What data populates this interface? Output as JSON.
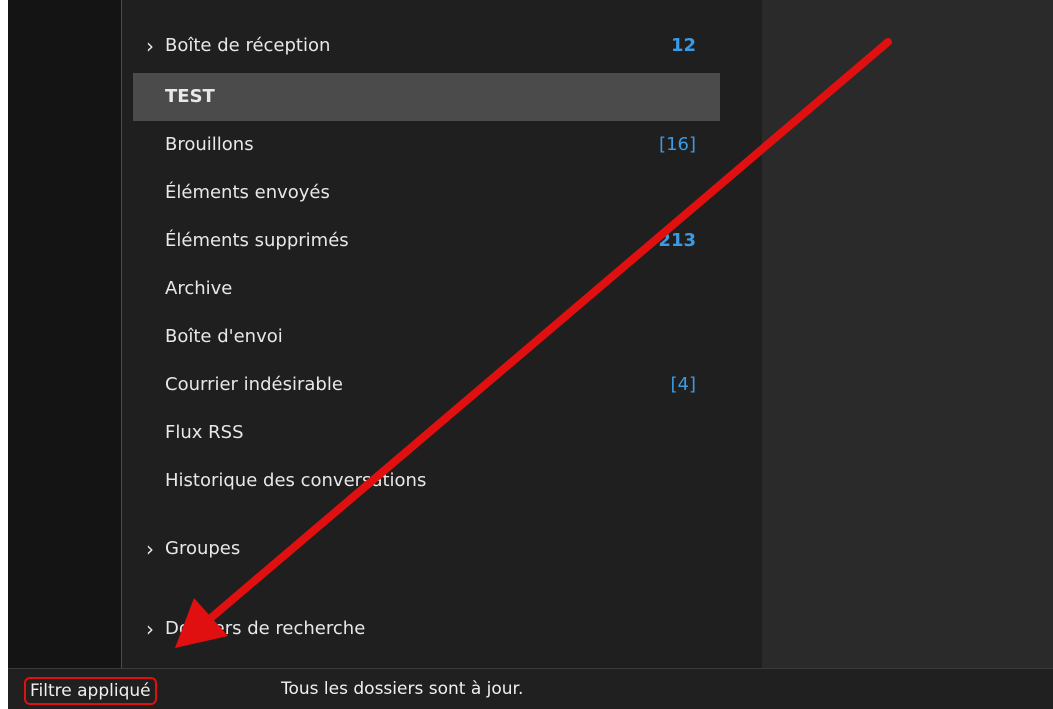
{
  "folders": [
    {
      "label": "Boîte de réception",
      "count": "12",
      "expandable": true
    },
    {
      "label": "TEST",
      "count": "",
      "selected": true,
      "bold": true
    },
    {
      "label": "Brouillons",
      "count": "[16]"
    },
    {
      "label": "Éléments envoyés",
      "count": ""
    },
    {
      "label": "Éléments supprimés",
      "count": "213"
    },
    {
      "label": "Archive",
      "count": ""
    },
    {
      "label": "Boîte d'envoi",
      "count": ""
    },
    {
      "label": "Courrier indésirable",
      "count": "[4]"
    },
    {
      "label": "Flux RSS",
      "count": ""
    },
    {
      "label": "Historique des conversations",
      "count": ""
    }
  ],
  "sections": [
    {
      "label": "Groupes"
    },
    {
      "label": "Dossiers de recherche"
    }
  ],
  "status_bar": {
    "filter": "Filtre appliqué",
    "sync": "Tous les dossiers sont à jour."
  },
  "colors": {
    "count_accent": "#3b9ae1",
    "annotation": "#e01010",
    "selected_row": "#4b4b4b"
  }
}
